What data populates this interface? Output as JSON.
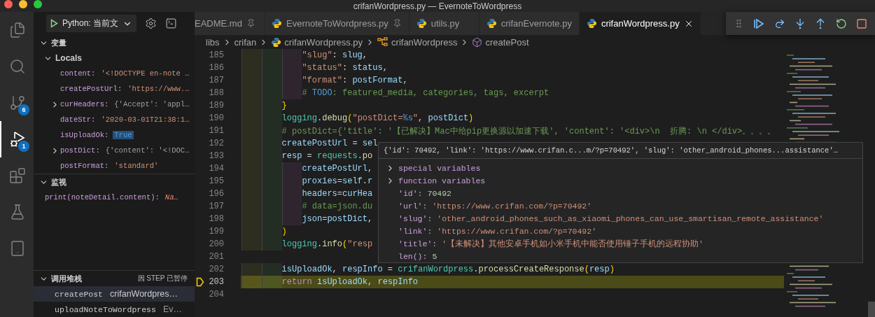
{
  "window": {
    "title": "crifanWordpress.py — EvernoteToWordpress"
  },
  "activity_bar": [
    {
      "kind": "explorer",
      "selected": false
    },
    {
      "kind": "search",
      "selected": false
    },
    {
      "kind": "source_control",
      "selected": false,
      "badge": "6"
    },
    {
      "kind": "debug",
      "selected": true,
      "badge": "1"
    },
    {
      "kind": "extensions",
      "selected": false
    },
    {
      "kind": "testing",
      "selected": false
    },
    {
      "kind": "device",
      "selected": false
    }
  ],
  "debug_launch": {
    "config": "Python: 当前文"
  },
  "variables": {
    "title": "变量",
    "expanded": true,
    "scope": {
      "title": "Locals",
      "expanded": true
    },
    "items": [
      {
        "name": "content:",
        "value": "'<!DOCTYPE en-note …",
        "kind": "string",
        "expandable": false,
        "changed": false
      },
      {
        "name": "createPostUrl:",
        "value": "'https://www.…",
        "kind": "string",
        "expandable": false,
        "changed": false
      },
      {
        "name": "curHeaders:",
        "value": "{'Accept': 'appl…",
        "kind": "object",
        "expandable": true,
        "changed": false
      },
      {
        "name": "dateStr:",
        "value": "'2020-03-01T21:38:1…",
        "kind": "string",
        "expandable": false,
        "changed": false
      },
      {
        "name": "isUploadOk:",
        "value": "True",
        "kind": "bool",
        "expandable": false,
        "changed": true
      },
      {
        "name": "postDict:",
        "value": "{'content': '<!DOC…",
        "kind": "object",
        "expandable": true,
        "changed": false
      },
      {
        "name": "postFormat:",
        "value": "'standard'",
        "kind": "string",
        "expandable": false,
        "changed": false
      }
    ]
  },
  "watch": {
    "title": "监视",
    "expanded": true,
    "items": [
      {
        "expression": "print(noteDetail.content):",
        "value": "Na…",
        "kind": "error"
      }
    ]
  },
  "call_stack": {
    "title": "调用堆栈",
    "expanded": true,
    "status": "因 STEP 已暂停",
    "frames": [
      {
        "name": "createPost",
        "source": "crifanWordpres…",
        "selected": true
      },
      {
        "name": "uploadNoteToWordpress",
        "source": "Ev…",
        "selected": false
      }
    ]
  },
  "tabs": [
    {
      "label": "EADME.md",
      "kind": "markdown",
      "pinned": true,
      "selected": false
    },
    {
      "label": "EvernoteToWordpress.py",
      "kind": "python",
      "pinned": true,
      "selected": false
    },
    {
      "label": "utils.py",
      "kind": "python",
      "pinned": false,
      "selected": false
    },
    {
      "label": "crifanEvernote.py",
      "kind": "python",
      "pinned": false,
      "selected": false
    },
    {
      "label": "crifanWordpress.py",
      "kind": "python",
      "pinned": false,
      "selected": true
    }
  ],
  "breadcrumb": [
    {
      "label": "libs",
      "kind": "folder"
    },
    {
      "label": "crifan",
      "kind": "folder"
    },
    {
      "label": "crifanWordpress.py",
      "kind": "file"
    },
    {
      "label": "crifanWordpress",
      "kind": "module"
    },
    {
      "label": "createPost",
      "kind": "method"
    }
  ],
  "code": {
    "lines": [
      {
        "number": "185",
        "current": false,
        "tokens": [
          {
            "text": "            \"slug\"",
            "kind": "str"
          },
          {
            "text": ": ",
            "kind": "punc"
          },
          {
            "text": "slug",
            "kind": "var"
          },
          {
            "text": ",",
            "kind": "punc"
          }
        ]
      },
      {
        "number": "186",
        "current": false,
        "tokens": [
          {
            "text": "            \"status\"",
            "kind": "str"
          },
          {
            "text": ": ",
            "kind": "punc"
          },
          {
            "text": "status",
            "kind": "var"
          },
          {
            "text": ",",
            "kind": "punc"
          }
        ]
      },
      {
        "number": "187",
        "current": false,
        "tokens": [
          {
            "text": "            \"format\"",
            "kind": "str"
          },
          {
            "text": ": ",
            "kind": "punc"
          },
          {
            "text": "postFormat",
            "kind": "var"
          },
          {
            "text": ",",
            "kind": "punc"
          }
        ]
      },
      {
        "number": "188",
        "current": false,
        "tokens": [
          {
            "text": "            # ",
            "kind": "comment"
          },
          {
            "text": "TODO",
            "kind": "todo"
          },
          {
            "text": ": featured_media, categories, tags, excerpt",
            "kind": "comment"
          }
        ]
      },
      {
        "number": "189",
        "current": false,
        "tokens": [
          {
            "text": "        }",
            "kind": "brace"
          }
        ]
      },
      {
        "number": "190",
        "current": false,
        "tokens": [
          {
            "text": "        logging",
            "kind": "cls"
          },
          {
            "text": ".",
            "kind": "punc"
          },
          {
            "text": "debug",
            "kind": "fn"
          },
          {
            "text": "(",
            "kind": "brace"
          },
          {
            "text": "\"postDict=",
            "kind": "str"
          },
          {
            "text": "%s",
            "kind": "fmt"
          },
          {
            "text": "\"",
            "kind": "str"
          },
          {
            "text": ", ",
            "kind": "punc"
          },
          {
            "text": "postDict",
            "kind": "var"
          },
          {
            "text": ")",
            "kind": "brace"
          }
        ]
      },
      {
        "number": "191",
        "current": false,
        "tokens": [
          {
            "text": "        # postDict={'title': '【已解决】Mac中给pip更换源以加速下载', 'content': '<div>\\n  折腾: \\n </div>。。。。",
            "kind": "comment"
          }
        ]
      },
      {
        "number": "192",
        "current": false,
        "tokens": [
          {
            "text": "        createPostUrl",
            "kind": "var"
          },
          {
            "text": " = ",
            "kind": "punc"
          },
          {
            "text": "sel",
            "kind": "var"
          }
        ]
      },
      {
        "number": "193",
        "current": false,
        "tokens": [
          {
            "text": "        resp",
            "kind": "var"
          },
          {
            "text": " = ",
            "kind": "punc"
          },
          {
            "text": "requests",
            "kind": "cls"
          },
          {
            "text": ".",
            "kind": "punc"
          },
          {
            "text": "po",
            "kind": "fn"
          }
        ]
      },
      {
        "number": "194",
        "current": false,
        "tokens": [
          {
            "text": "            createPostUrl",
            "kind": "var"
          },
          {
            "text": ",",
            "kind": "punc"
          }
        ]
      },
      {
        "number": "195",
        "current": false,
        "tokens": [
          {
            "text": "            proxies",
            "kind": "var"
          },
          {
            "text": "=",
            "kind": "punc"
          },
          {
            "text": "self",
            "kind": "var"
          },
          {
            "text": ".",
            "kind": "punc"
          },
          {
            "text": "r",
            "kind": "var"
          }
        ]
      },
      {
        "number": "196",
        "current": false,
        "tokens": [
          {
            "text": "            headers",
            "kind": "var"
          },
          {
            "text": "=",
            "kind": "punc"
          },
          {
            "text": "curHea",
            "kind": "var"
          }
        ]
      },
      {
        "number": "197",
        "current": false,
        "tokens": [
          {
            "text": "            # data=json.du",
            "kind": "comment"
          }
        ]
      },
      {
        "number": "198",
        "current": false,
        "tokens": [
          {
            "text": "            json",
            "kind": "var"
          },
          {
            "text": "=",
            "kind": "punc"
          },
          {
            "text": "postDict",
            "kind": "var"
          },
          {
            "text": ",",
            "kind": "punc"
          }
        ]
      },
      {
        "number": "199",
        "current": false,
        "tokens": [
          {
            "text": "        )",
            "kind": "brace"
          }
        ]
      },
      {
        "number": "200",
        "current": false,
        "tokens": [
          {
            "text": "        logging",
            "kind": "cls"
          },
          {
            "text": ".",
            "kind": "punc"
          },
          {
            "text": "info",
            "kind": "fn"
          },
          {
            "text": "(",
            "kind": "brace"
          },
          {
            "text": "\"resp",
            "kind": "str"
          }
        ]
      },
      {
        "number": "201",
        "current": false
      },
      {
        "number": "202",
        "current": false,
        "tokens": [
          {
            "text": "        isUploadOk",
            "kind": "var"
          },
          {
            "text": ", ",
            "kind": "punc"
          },
          {
            "text": "respInfo",
            "kind": "var"
          },
          {
            "text": " = ",
            "kind": "punc"
          },
          {
            "text": "crifanWordpress",
            "kind": "cls"
          },
          {
            "text": ".",
            "kind": "punc"
          },
          {
            "text": "processCreateResponse",
            "kind": "fn"
          },
          {
            "text": "(",
            "kind": "brace"
          },
          {
            "text": "resp",
            "kind": "var"
          },
          {
            "text": ")",
            "kind": "brace"
          }
        ]
      },
      {
        "number": "203",
        "current": true,
        "tokens": [
          {
            "text": "        return",
            "kind": "keyword"
          },
          {
            "text": " isUploadOk",
            "kind": "var"
          },
          {
            "text": ", ",
            "kind": "punc"
          },
          {
            "text": "respInfo",
            "kind": "var"
          }
        ]
      },
      {
        "number": "204",
        "current": false
      }
    ]
  },
  "hover": {
    "summary": "{'id': 70492, 'link': 'https://www.crifan.c...m/?p=70492', 'slug': 'other_android_phones...assistance'…",
    "items": [
      {
        "kind": "group",
        "key": "special variables"
      },
      {
        "kind": "group",
        "key": "function variables"
      },
      {
        "kind": "number",
        "key": "'id':",
        "value": "70492"
      },
      {
        "kind": "string",
        "key": "'url':",
        "value": "'https://www.crifan.com/?p=70492'"
      },
      {
        "kind": "string",
        "key": "'slug':",
        "value": "'other_android_phones_such_as_xiaomi_phones_can_use_smartisan_remote_assistance'"
      },
      {
        "kind": "string",
        "key": "'link':",
        "value": "'https://www.crifan.com/?p=70492'"
      },
      {
        "kind": "string",
        "key": "'title':",
        "value": "'【未解决】其他安卓手机如小米手机中能否使用锤子手机的远程协助'"
      },
      {
        "kind": "number",
        "key": "len():",
        "value": "5"
      }
    ]
  }
}
